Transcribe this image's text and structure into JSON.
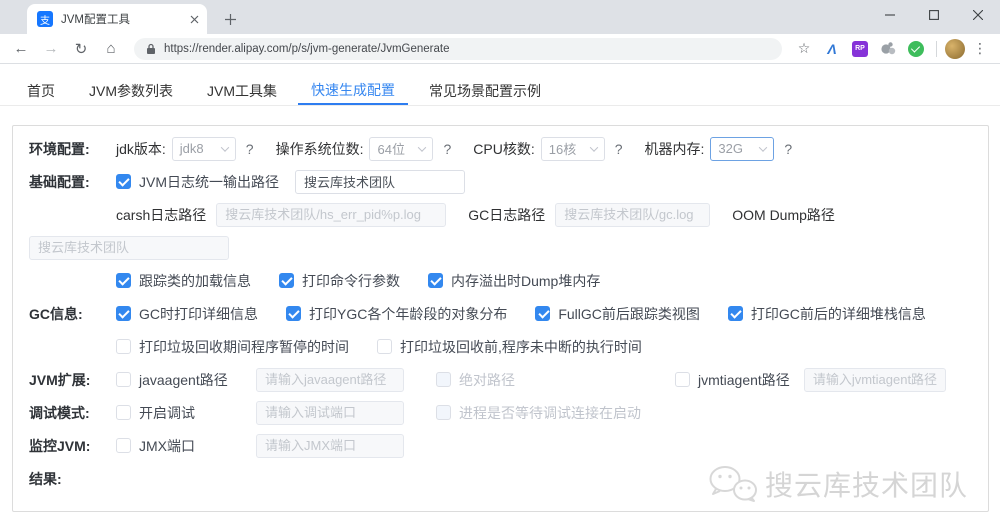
{
  "browser": {
    "tab_title": "JVM配置工具",
    "favicon_glyph": "支",
    "url": "https://render.alipay.com/p/s/jvm-generate/JvmGenerate",
    "extensions": {
      "axure": "Λ",
      "rp": "RP"
    }
  },
  "icons": {
    "back": "←",
    "forward": "→",
    "reload": "↻",
    "home": "⌂",
    "star": "☆",
    "menu": "⋮"
  },
  "nav": {
    "items": [
      "首页",
      "JVM参数列表",
      "JVM工具集",
      "快速生成配置",
      "常见场景配置示例"
    ],
    "active": "快速生成配置"
  },
  "form": {
    "env": {
      "label": "环境配置:",
      "jdk_label": "jdk版本:",
      "jdk_value": "jdk8",
      "os_label": "操作系统位数:",
      "os_value": "64位",
      "cpu_label": "CPU核数:",
      "cpu_value": "16核",
      "mem_label": "机器内存:",
      "mem_value": "32G",
      "help": "?"
    },
    "basic": {
      "label": "基础配置:",
      "log_path_checkbox": "JVM日志统一输出路径",
      "log_path_value": "搜云库技术团队",
      "crash_label": "carsh日志路径",
      "crash_placeholder": "搜云库技术团队/hs_err_pid%p.log",
      "gc_label": "GC日志路径",
      "gc_placeholder": "搜云库技术团队/gc.log",
      "oom_label": "OOM Dump路径",
      "oom_placeholder": "搜云库技术团队",
      "checks": [
        "跟踪类的加载信息",
        "打印命令行参数",
        "内存溢出时Dump堆内存"
      ]
    },
    "gc": {
      "label": "GC信息:",
      "checked": [
        "GC时打印详细信息",
        "打印YGC各个年龄段的对象分布",
        "FullGC前后跟踪类视图",
        "打印GC前后的详细堆栈信息"
      ],
      "unchecked": [
        "打印垃圾回收期间程序暂停的时间",
        "打印垃圾回收前,程序未中断的执行时间"
      ]
    },
    "ext": {
      "label": "JVM扩展:",
      "javaagent_checkbox": "javaagent路径",
      "javaagent_placeholder": "请输入javaagent路径",
      "absolute_checkbox": "绝对路径",
      "jvmtiagent_checkbox": "jvmtiagent路径",
      "jvmtiagent_placeholder": "请输入jvmtiagent路径"
    },
    "debug": {
      "label": "调试模式:",
      "enable_checkbox": "开启调试",
      "port_placeholder": "请输入调试端口",
      "wait_checkbox": "进程是否等待调试连接在启动"
    },
    "monitor": {
      "label": "监控JVM:",
      "jmx_checkbox": "JMX端口",
      "jmx_placeholder": "请输入JMX端口"
    },
    "result_label": "结果:"
  },
  "watermark": {
    "text": "搜云库技术团队"
  },
  "colors": {
    "accent": "#3687f0",
    "checkbox": "#3388ef",
    "placeholder": "#c3c7cd",
    "chrome_strip": "#dee1e6"
  }
}
